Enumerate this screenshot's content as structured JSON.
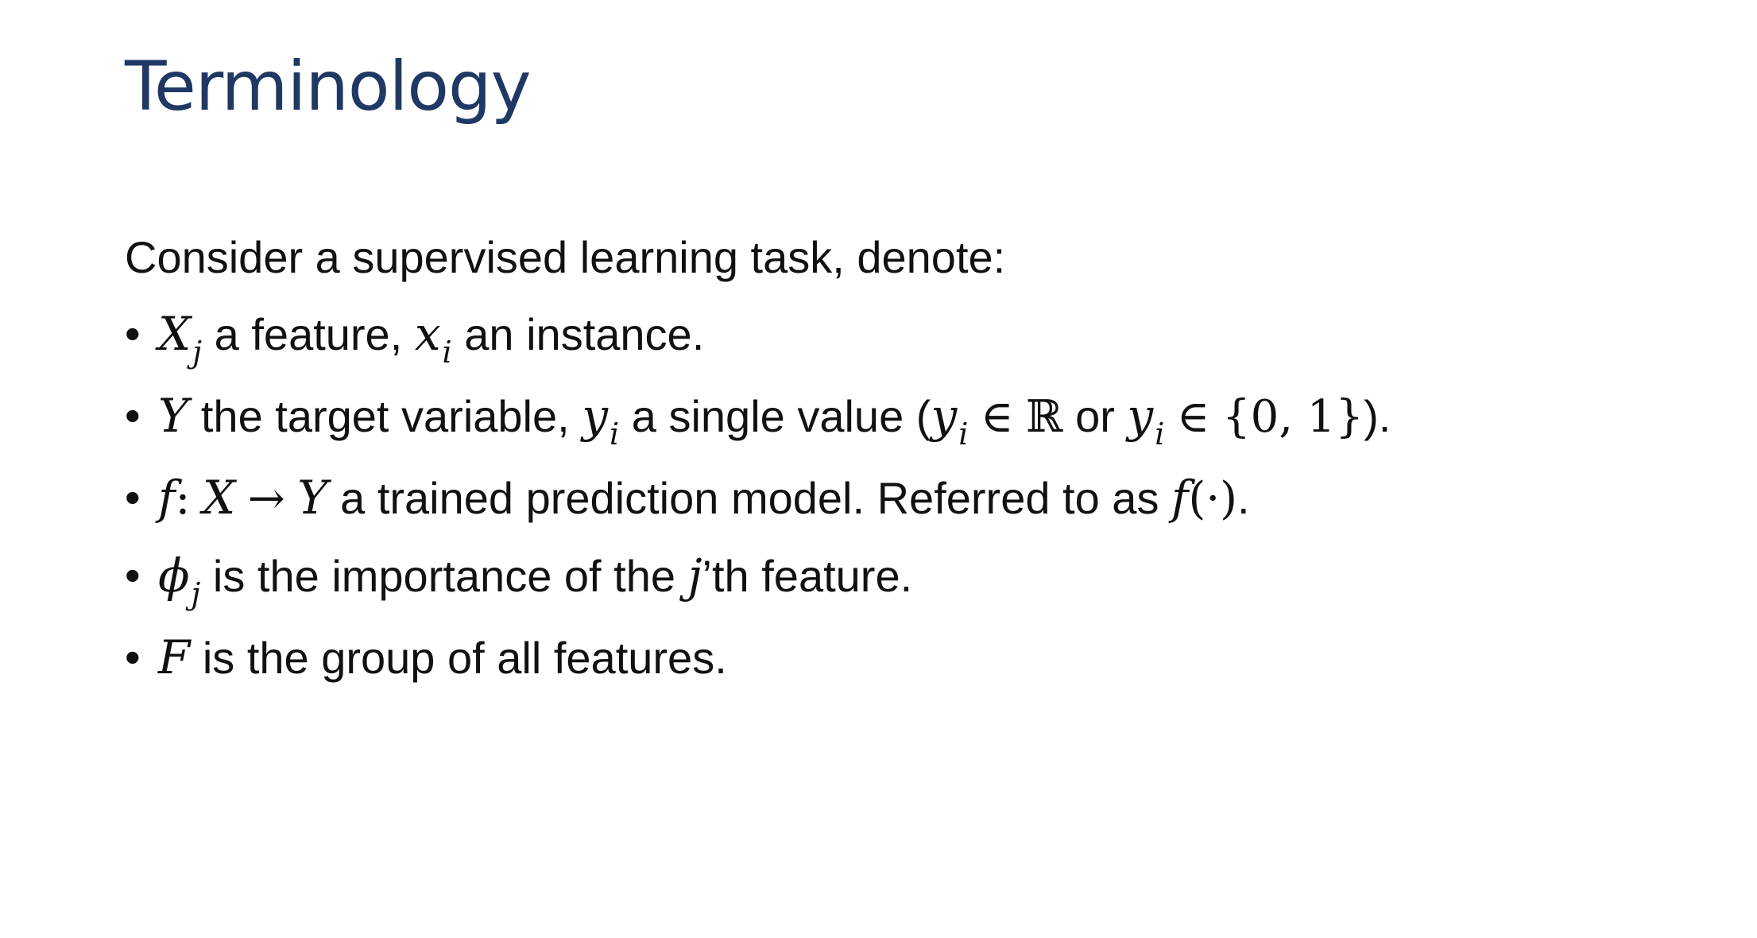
{
  "slide": {
    "title": "Terminology",
    "intro": "Consider a supervised learning task, denote:",
    "accent_color": "#1f3864",
    "bullet_glyph": "•",
    "bullets": [
      {
        "X": "X",
        "j": "j",
        "t1": "a feature,",
        "x": "x",
        "i": "i",
        "t2": "an instance."
      },
      {
        "Y": "Y",
        "t1": "the target variable,",
        "y": "y",
        "i": "i",
        "t2": "a single value (",
        "y2": "y",
        "i2": "i",
        "in1": "∈",
        "R": "ℝ",
        "or": "or",
        "y3": "y",
        "i3": "i",
        "in2": "∈",
        "set": "{0, 1}",
        "t3": ")."
      },
      {
        "f": "f",
        "colon": ":",
        "X": "X",
        "arrow": "→",
        "Y": "Y",
        "t1": "a trained prediction model. Referred to as",
        "f2": "f",
        "paren": "(·)",
        "t2": "."
      },
      {
        "phi": "ϕ",
        "j": "j",
        "t1": "is the importance of the",
        "j2": "j",
        "t2": "’th feature."
      },
      {
        "F": "F",
        "t1": "is the group of all features."
      }
    ]
  }
}
